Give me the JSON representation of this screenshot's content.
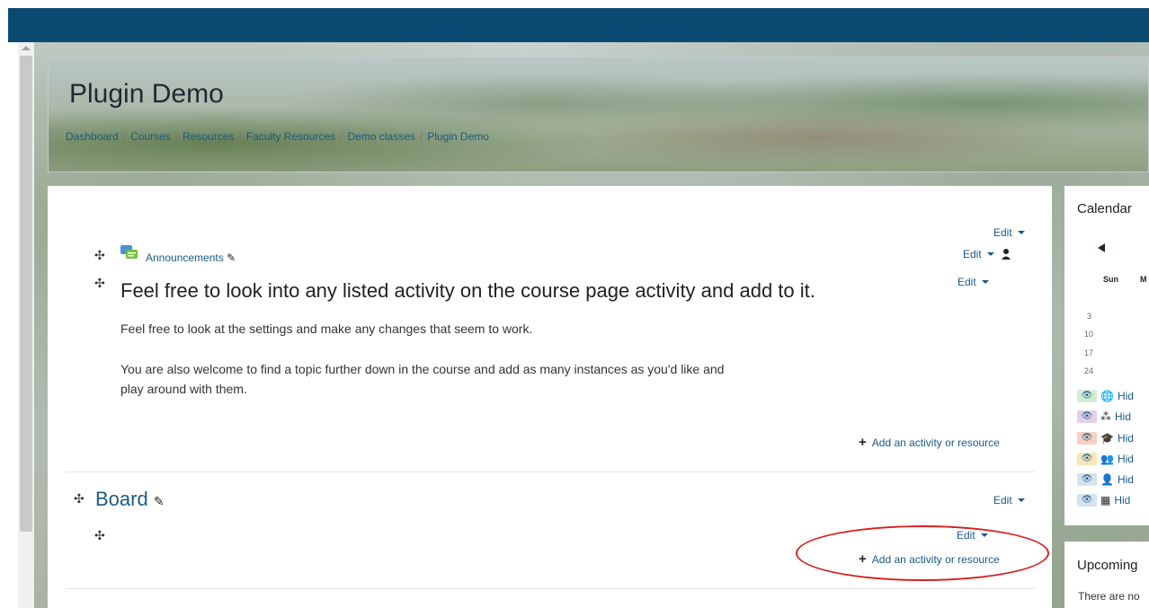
{
  "course": {
    "title": "Plugin Demo",
    "breadcrumb": [
      "Dashboard",
      "Courses",
      "Resources",
      "Faculty Resources",
      "Demo classes",
      "Plugin Demo"
    ],
    "breadcrumb_separator": "/"
  },
  "edit_label": "Edit",
  "add_activity_label": "Add an activity or resource",
  "section0": {
    "announcements_label": "Announcements",
    "heading": "Feel free to look into any listed activity on the course page activity and add to it.",
    "para1": "Feel free to look at the settings and make any changes that seem to work.",
    "para2_line1": "You are also welcome to find a topic further down in the course and add as many instances as you'd like and",
    "para2_line2": "play around with them."
  },
  "section1": {
    "title": "Board"
  },
  "calendar": {
    "title": "Calendar",
    "day_header": "Sun",
    "day_header2": "M",
    "days": [
      "3",
      "10",
      "17",
      "24"
    ],
    "legend": [
      {
        "label": "Hid",
        "icon": "globe-icon",
        "bg": "#d4ecd4"
      },
      {
        "label": "Hid",
        "icon": "cubes-icon",
        "bg": "#e3cfe6"
      },
      {
        "label": "Hid",
        "icon": "graduation-cap-icon",
        "bg": "#f6d0c2"
      },
      {
        "label": "Hid",
        "icon": "users-icon",
        "bg": "#f7e6b8"
      },
      {
        "label": "Hid",
        "icon": "user-icon",
        "bg": "#d5e3ee"
      },
      {
        "label": "Hid",
        "icon": "calendar-icon",
        "bg": "#d5e3ee"
      }
    ]
  },
  "upcoming": {
    "title": "Upcoming",
    "text": "There are no"
  },
  "colors": {
    "topbar": "#0b4a72",
    "link": "#1a5a85",
    "highlight_ellipse": "#d62020"
  }
}
